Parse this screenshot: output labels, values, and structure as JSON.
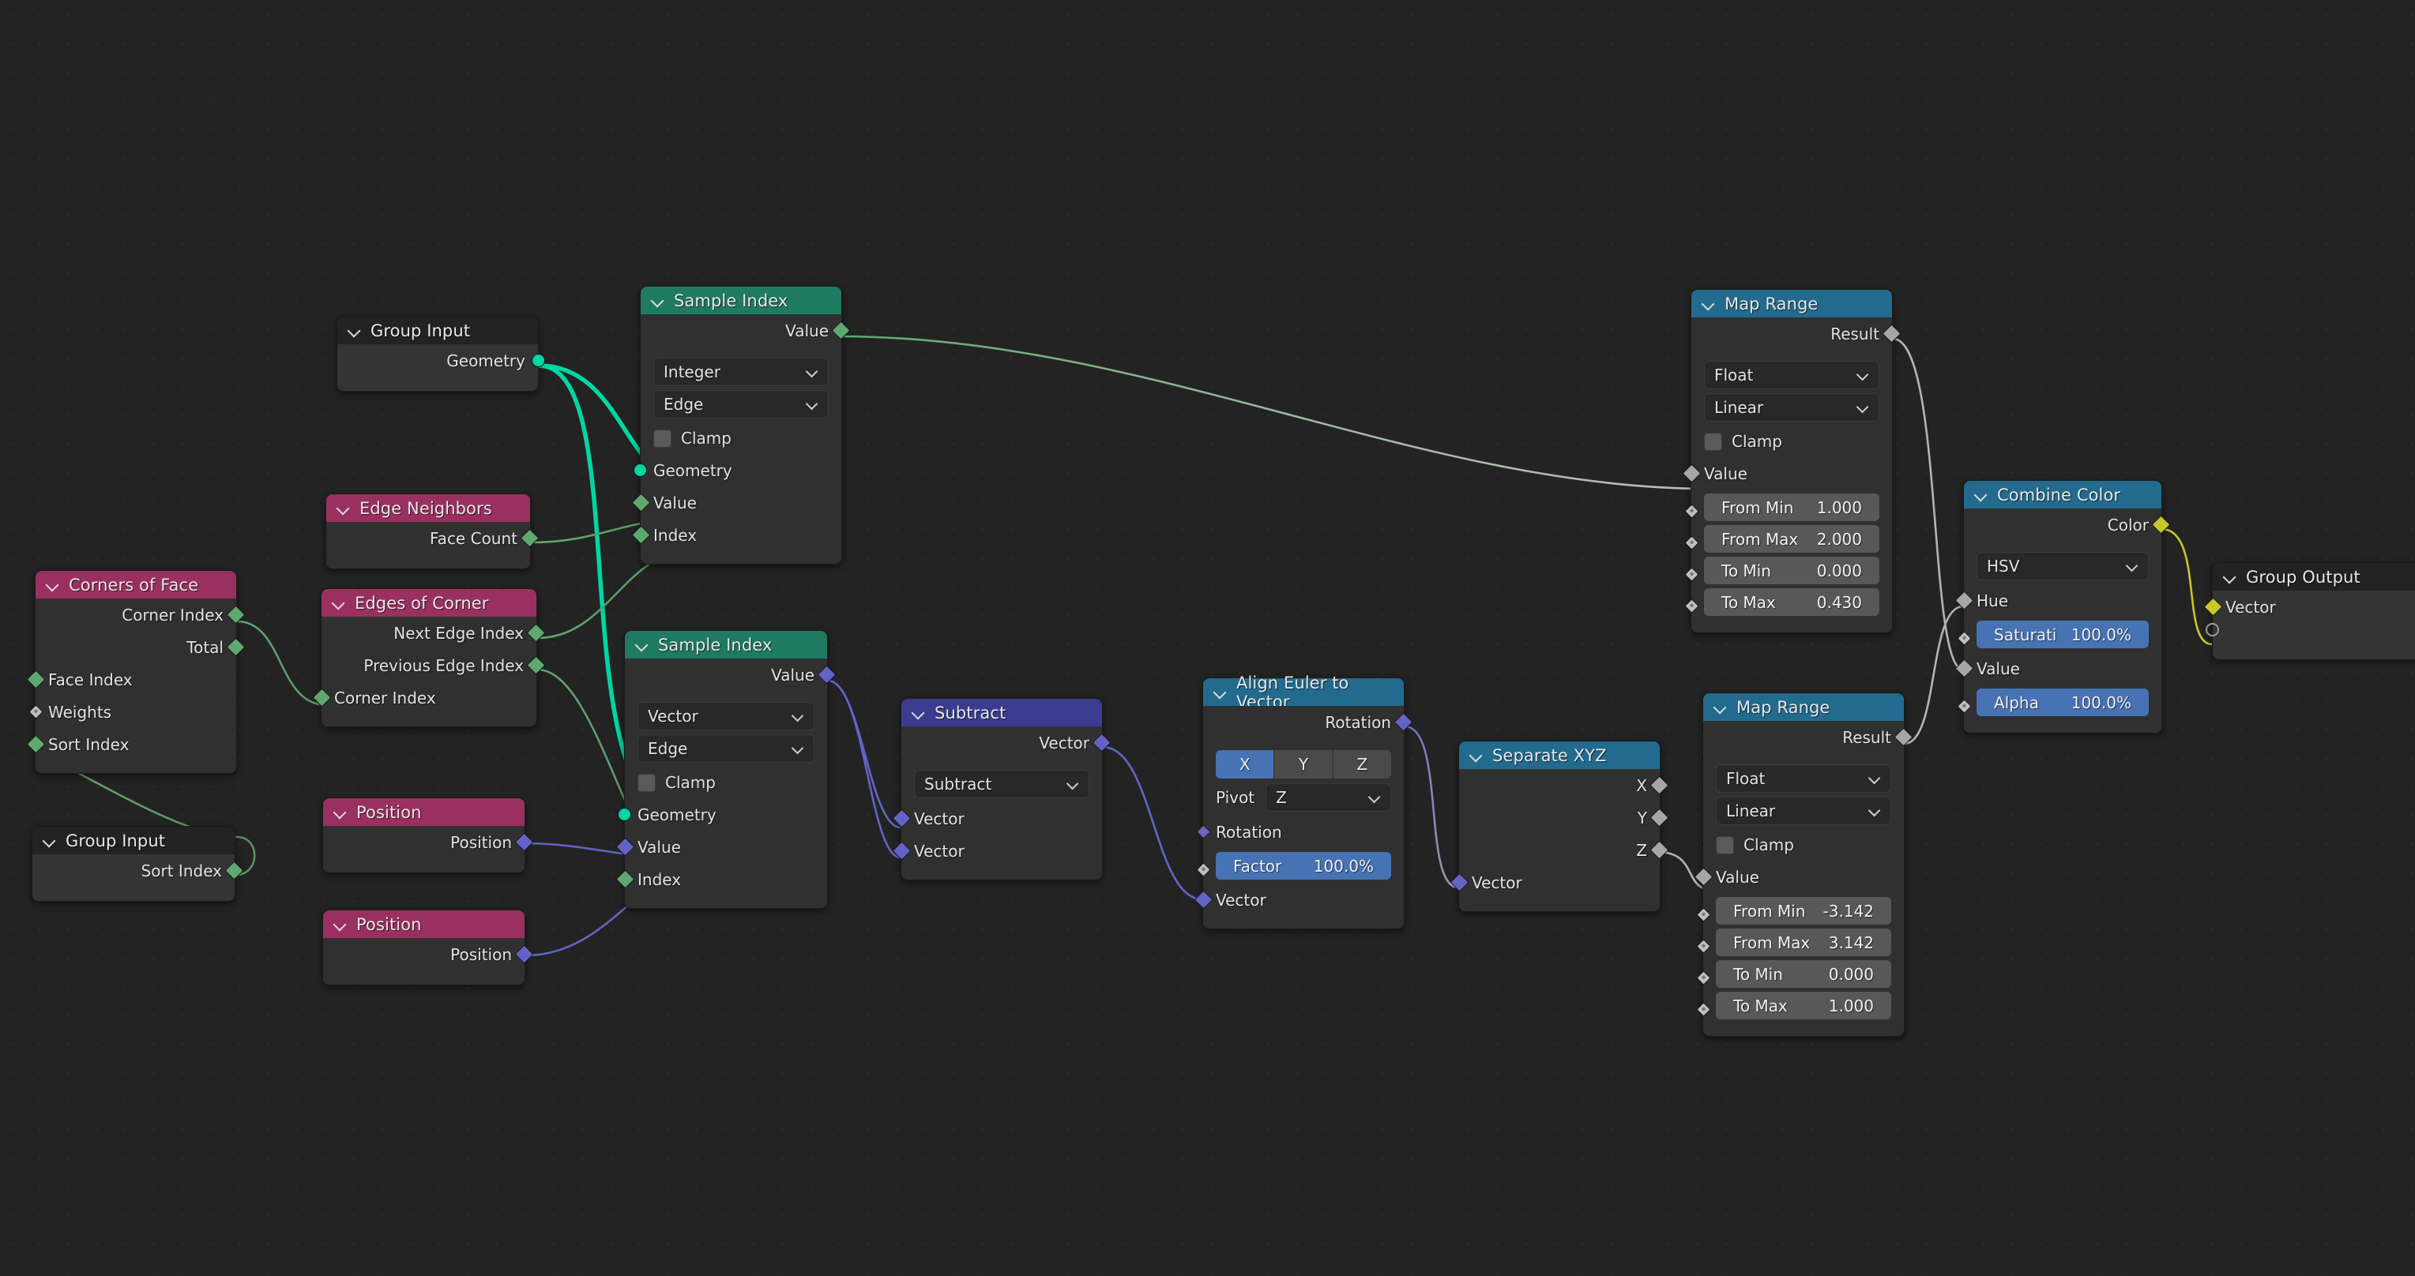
{
  "editor": {
    "name": "blender-geometry-node-editor",
    "background": "#232323"
  },
  "colors": {
    "header_red": "#9a3060",
    "header_green": "#1f7a62",
    "header_blue": "#3b3b8f",
    "header_teal": "#226b8f",
    "header_grey": "#222222",
    "node_body": "#303030",
    "socket_geometry": "#00d6a3",
    "socket_int": "#5fa86f",
    "socket_vector": "#6363c7",
    "socket_float": "#a1a1a1",
    "socket_color": "#c7c729",
    "widget_blue": "#4772b3"
  },
  "nodes": {
    "group_input_top": {
      "title": "Group Input",
      "outputs": [
        {
          "label": "Geometry",
          "type": "geometry"
        }
      ]
    },
    "sample_index_top": {
      "title": "Sample Index",
      "outputs": [
        {
          "label": "Value",
          "type": "int"
        }
      ],
      "data_type": "Integer",
      "domain": "Edge",
      "clamp_label": "Clamp",
      "inputs": [
        {
          "label": "Geometry",
          "type": "geometry"
        },
        {
          "label": "Value",
          "type": "int"
        },
        {
          "label": "Index",
          "type": "int"
        }
      ]
    },
    "edge_neighbors": {
      "title": "Edge Neighbors",
      "outputs": [
        {
          "label": "Face Count",
          "type": "int"
        }
      ]
    },
    "edges_of_corner": {
      "title": "Edges of Corner",
      "outputs": [
        {
          "label": "Next Edge Index",
          "type": "int"
        },
        {
          "label": "Previous Edge Index",
          "type": "int"
        }
      ],
      "inputs": [
        {
          "label": "Corner Index",
          "type": "int"
        }
      ]
    },
    "corners_of_face": {
      "title": "Corners of Face",
      "outputs": [
        {
          "label": "Corner Index",
          "type": "int"
        },
        {
          "label": "Total",
          "type": "int"
        }
      ],
      "inputs": [
        {
          "label": "Face Index",
          "type": "int"
        },
        {
          "label": "Weights",
          "type": "float"
        },
        {
          "label": "Sort Index",
          "type": "int"
        }
      ]
    },
    "group_input_bottom": {
      "title": "Group Input",
      "outputs": [
        {
          "label": "Sort Index",
          "type": "int"
        }
      ]
    },
    "position_top": {
      "title": "Position",
      "outputs": [
        {
          "label": "Position",
          "type": "vector"
        }
      ]
    },
    "position_bottom": {
      "title": "Position",
      "outputs": [
        {
          "label": "Position",
          "type": "vector"
        }
      ]
    },
    "sample_index_bottom": {
      "title": "Sample Index",
      "outputs": [
        {
          "label": "Value",
          "type": "vector"
        }
      ],
      "data_type": "Vector",
      "domain": "Edge",
      "clamp_label": "Clamp",
      "inputs": [
        {
          "label": "Geometry",
          "type": "geometry"
        },
        {
          "label": "Value",
          "type": "vector"
        },
        {
          "label": "Index",
          "type": "int"
        }
      ]
    },
    "subtract": {
      "title": "Subtract",
      "outputs": [
        {
          "label": "Vector",
          "type": "vector"
        }
      ],
      "operation": "Subtract",
      "inputs": [
        {
          "label": "Vector",
          "type": "vector"
        },
        {
          "label": "Vector",
          "type": "vector"
        }
      ]
    },
    "align_euler": {
      "title": "Align Euler to Vector",
      "outputs": [
        {
          "label": "Rotation",
          "type": "vector"
        }
      ],
      "axis_options": [
        "X",
        "Y",
        "Z"
      ],
      "axis_active": "X",
      "pivot_label": "Pivot",
      "pivot_value": "Z",
      "inputs": [
        {
          "label": "Rotation",
          "type": "vector_sub"
        },
        {
          "label": "Vector",
          "type": "vector"
        }
      ],
      "factor": {
        "label": "Factor",
        "value": "100.0%"
      }
    },
    "separate_xyz": {
      "title": "Separate XYZ",
      "outputs": [
        {
          "label": "X",
          "type": "float"
        },
        {
          "label": "Y",
          "type": "float"
        },
        {
          "label": "Z",
          "type": "float"
        }
      ],
      "inputs": [
        {
          "label": "Vector",
          "type": "vector"
        }
      ]
    },
    "map_range_top": {
      "title": "Map Range",
      "outputs": [
        {
          "label": "Result",
          "type": "float"
        }
      ],
      "data_type": "Float",
      "interpolation": "Linear",
      "clamp_label": "Clamp",
      "value_label": "Value",
      "fields": [
        {
          "label": "From Min",
          "value": "1.000"
        },
        {
          "label": "From Max",
          "value": "2.000"
        },
        {
          "label": "To Min",
          "value": "0.000"
        },
        {
          "label": "To Max",
          "value": "0.430"
        }
      ]
    },
    "map_range_bottom": {
      "title": "Map Range",
      "outputs": [
        {
          "label": "Result",
          "type": "float"
        }
      ],
      "data_type": "Float",
      "interpolation": "Linear",
      "clamp_label": "Clamp",
      "value_label": "Value",
      "fields": [
        {
          "label": "From Min",
          "value": "-3.142"
        },
        {
          "label": "From Max",
          "value": "3.142"
        },
        {
          "label": "To Min",
          "value": "0.000"
        },
        {
          "label": "To Max",
          "value": "1.000"
        }
      ]
    },
    "combine_color": {
      "title": "Combine Color",
      "outputs": [
        {
          "label": "Color",
          "type": "color"
        }
      ],
      "mode": "HSV",
      "inputs": [
        {
          "label": "Hue",
          "type": "float"
        },
        {
          "label": "Value",
          "type": "float"
        }
      ],
      "saturation": {
        "label": "Saturati",
        "value": "100.0%"
      },
      "alpha": {
        "label": "Alpha",
        "value": "100.0%"
      }
    },
    "group_output": {
      "title": "Group Output",
      "inputs": [
        {
          "label": "Vector",
          "type": "color"
        }
      ]
    }
  }
}
